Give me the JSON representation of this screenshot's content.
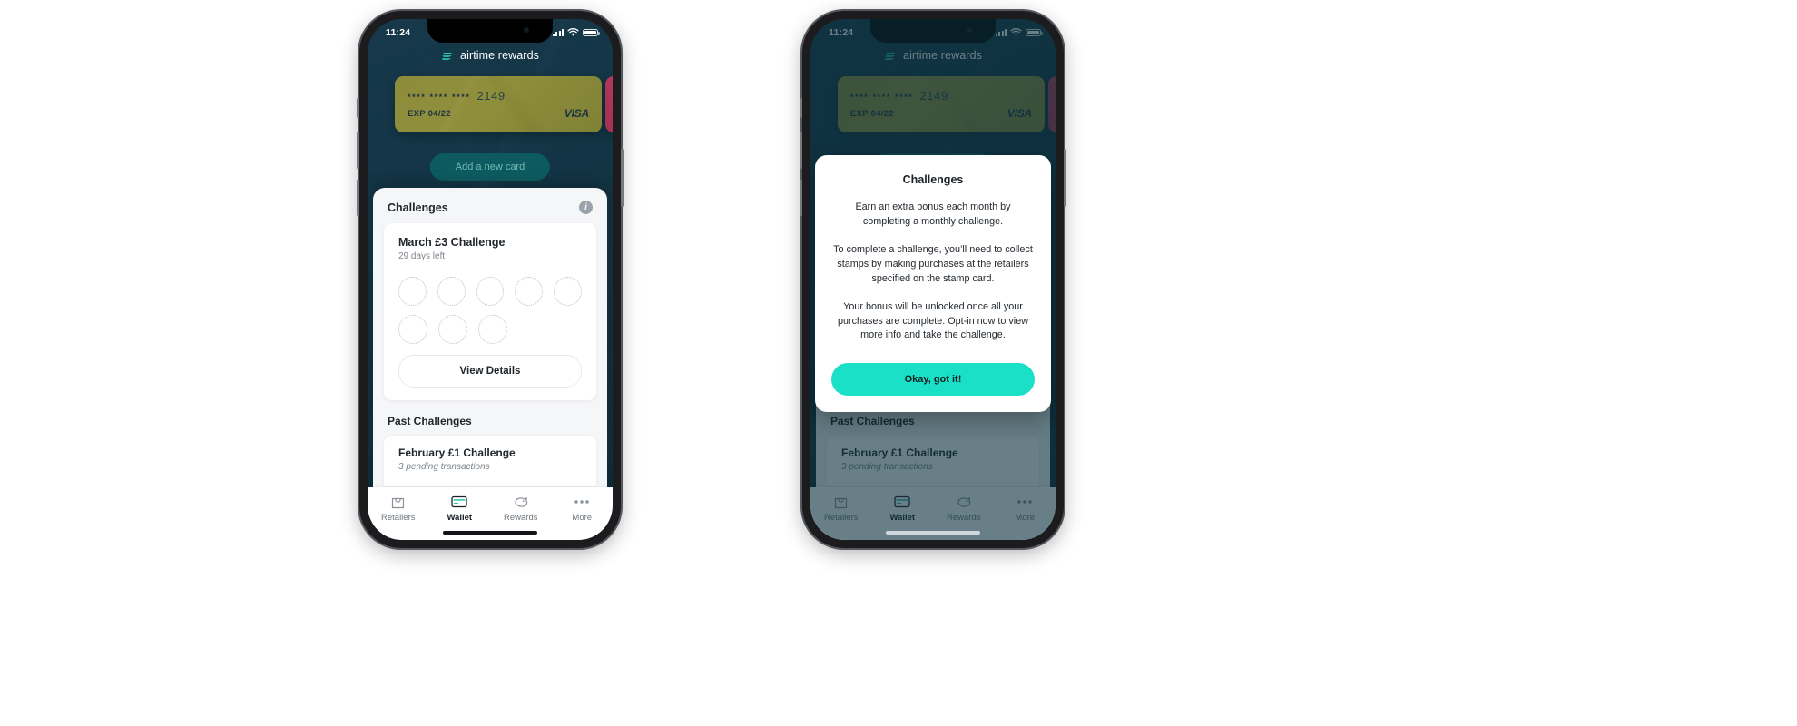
{
  "status_bar": {
    "time": "11:24",
    "signal_icon": "cellular-signal-icon",
    "wifi_icon": "wifi-icon",
    "battery_icon": "battery-icon"
  },
  "brand": {
    "name": "airtime rewards",
    "logo_icon": "airtime-wave-logo-icon",
    "accent": "#2fd8c0"
  },
  "wallet": {
    "card": {
      "masked_digits": "****  ****  ****",
      "last4": "2149",
      "expiry_label": "EXP 04/22",
      "network": "VISA",
      "color": "#8c8c3c"
    },
    "peek_card_color": "#b3395a",
    "add_card_label": "Add a new card"
  },
  "sheet": {
    "title": "Challenges",
    "info_icon": "info-circle-icon",
    "info_glyph": "i",
    "active_challenge": {
      "name": "March £3 Challenge",
      "time_left": "29 days left",
      "stamps_total": 8,
      "stamps_collected": 0,
      "stamp_rows": [
        5,
        3
      ],
      "cta_label": "View Details"
    },
    "past_section_title": "Past Challenges",
    "past_challenges": [
      {
        "name": "February £1 Challenge",
        "status": "3 pending transactions"
      }
    ]
  },
  "tabbar": {
    "items": [
      {
        "label": "Retailers",
        "icon": "shopping-bag-icon",
        "active": false
      },
      {
        "label": "Wallet",
        "icon": "credit-card-icon",
        "active": true
      },
      {
        "label": "Rewards",
        "icon": "piggy-bank-icon",
        "active": false
      },
      {
        "label": "More",
        "icon": "ellipsis-icon",
        "active": false
      }
    ],
    "active_color": "#29c3ac"
  },
  "modal": {
    "title": "Challenges",
    "paragraphs": [
      "Earn an extra bonus each month by completing a monthly challenge.",
      "To complete a challenge, you’ll need to collect stamps by making purchases at the retailers specified on the stamp card.",
      "Your bonus will be unlocked once all your purchases are complete. Opt-in now to view more info and take the challenge."
    ],
    "button_label": "Okay, got it!",
    "button_color": "#1ae0c8"
  }
}
